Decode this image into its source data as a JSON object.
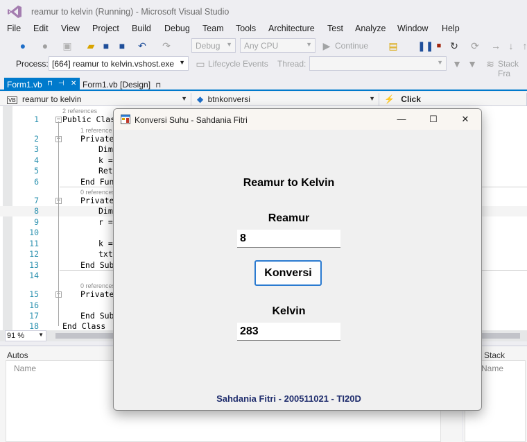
{
  "window": {
    "title": "reamur to kelvin (Running) - Microsoft Visual Studio"
  },
  "menu": [
    "File",
    "Edit",
    "View",
    "Project",
    "Build",
    "Debug",
    "Team",
    "Tools",
    "Architecture",
    "Test",
    "Analyze",
    "Window",
    "Help"
  ],
  "toolbar": {
    "config": "Debug",
    "platform": "Any CPU",
    "continue_label": "Continue",
    "lifecycle_label": "Lifecycle Events",
    "thread_label": "Thread:",
    "stackframe_label": "Stack Fra"
  },
  "process": {
    "label": "Process:",
    "value": "[664] reamur to kelvin.vshost.exe"
  },
  "tabs": [
    {
      "label": "Form1.vb",
      "active": true
    },
    {
      "label": "Form1.vb [Design]",
      "active": false
    }
  ],
  "navbar": {
    "project": "reamur to kelvin",
    "member": "btnkonversi",
    "event": "Click"
  },
  "code": {
    "ref_hints": [
      "2 references",
      "1 reference",
      "0 references",
      "0 references"
    ],
    "lines": [
      {
        "n": "1",
        "kw": "Public Class",
        "rest": ""
      },
      {
        "n": "2",
        "kw": "Private",
        "rest": ""
      },
      {
        "n": "3",
        "kw": "Dim",
        "rest": ""
      },
      {
        "n": "4",
        "kw": "",
        "rest": "k ="
      },
      {
        "n": "5",
        "kw": "Retu",
        "rest": ""
      },
      {
        "n": "6",
        "kw": "End Func",
        "rest": ""
      },
      {
        "n": "7",
        "kw": "Private",
        "rest": ""
      },
      {
        "n": "8",
        "kw": "Dim",
        "rest": ""
      },
      {
        "n": "9",
        "kw": "",
        "rest": "r ="
      },
      {
        "n": "10",
        "kw": "",
        "rest": ""
      },
      {
        "n": "11",
        "kw": "",
        "rest": "k ="
      },
      {
        "n": "12",
        "kw": "",
        "rest": "txt"
      },
      {
        "n": "13",
        "kw": "End Sub",
        "rest": ""
      },
      {
        "n": "14",
        "kw": "",
        "rest": ""
      },
      {
        "n": "15",
        "kw": "Private",
        "rest": ""
      },
      {
        "n": "16",
        "kw": "",
        "rest": ""
      },
      {
        "n": "17",
        "kw": "End Sub",
        "rest": ""
      },
      {
        "n": "18",
        "kw": "End Class",
        "rest": ""
      }
    ]
  },
  "zoom": "91 %",
  "panels": {
    "autos_title": "Autos",
    "autos_col": "Name",
    "stack_title": "Stack",
    "stack_col": "Name"
  },
  "app": {
    "title": "Konversi Suhu - Sahdania Fitri",
    "heading": "Reamur to Kelvin",
    "reamur_label": "Reamur",
    "reamur_value": "8",
    "button_label": "Konversi",
    "kelvin_label": "Kelvin",
    "kelvin_value": "283",
    "footer": "Sahdania Fitri - 200511021 - TI20D"
  },
  "colors": {
    "accent": "#007acc",
    "footer_text": "#1f2d6d",
    "button_border": "#2a7ad0"
  }
}
